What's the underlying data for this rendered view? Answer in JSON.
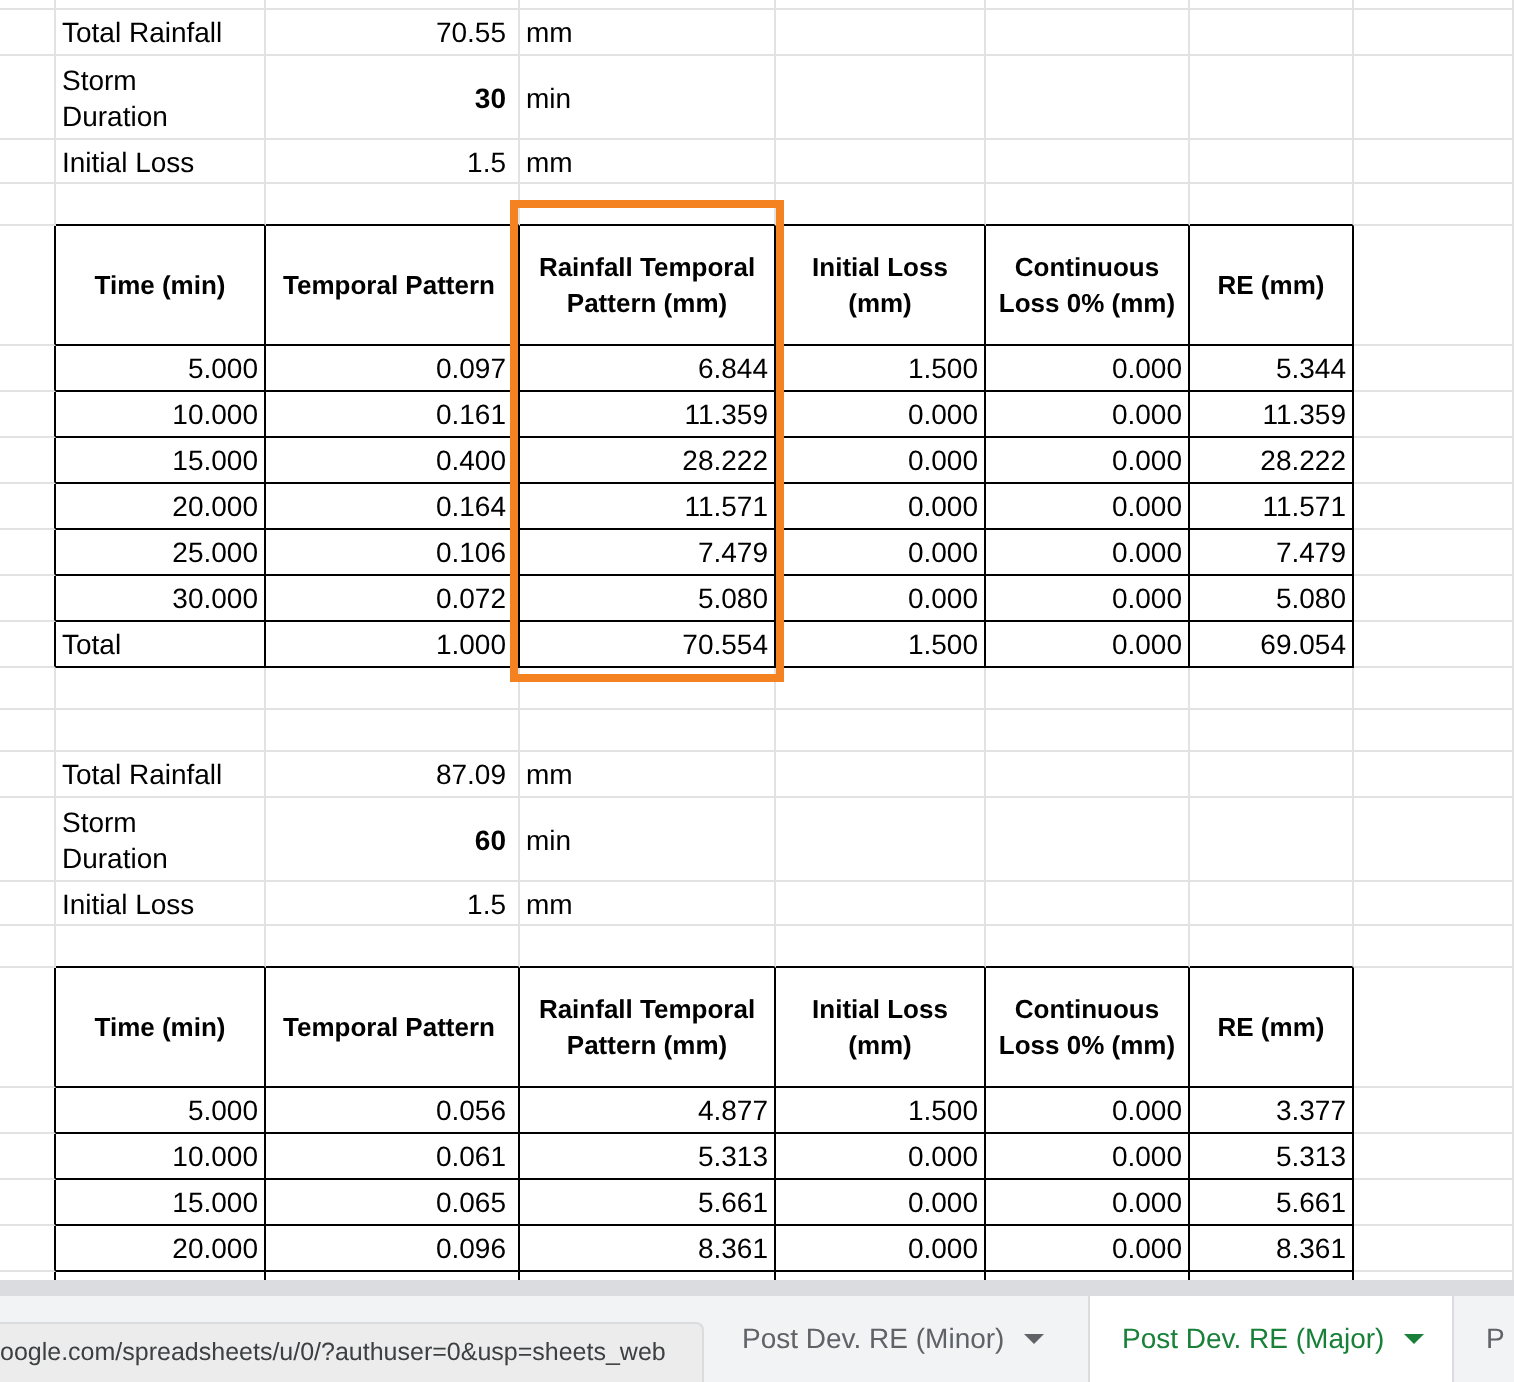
{
  "blocks": [
    {
      "parameters": [
        {
          "label": "Total Rainfall",
          "value": "70.55",
          "unit": "mm",
          "emphasis": false
        },
        {
          "label": "Storm Duration",
          "value": "30",
          "unit": "min",
          "emphasis": true
        },
        {
          "label": "Initial Loss",
          "value": "1.5",
          "unit": "mm",
          "emphasis": false
        }
      ],
      "table": {
        "columns": [
          {
            "label": "Time (min)",
            "highlighted": false
          },
          {
            "label": "Temporal Pattern",
            "highlighted": false
          },
          {
            "label": "Rainfall Temporal Pattern (mm)",
            "highlighted": true
          },
          {
            "label": "Initial Loss (mm)",
            "highlighted": false
          },
          {
            "label": "Continuous Loss 0% (mm)",
            "highlighted": false
          },
          {
            "label": "RE (mm)",
            "highlighted": false
          }
        ],
        "rows": [
          [
            "5.000",
            "0.097",
            "6.844",
            "1.500",
            "0.000",
            "5.344"
          ],
          [
            "10.000",
            "0.161",
            "11.359",
            "0.000",
            "0.000",
            "11.359"
          ],
          [
            "15.000",
            "0.400",
            "28.222",
            "0.000",
            "0.000",
            "28.222"
          ],
          [
            "20.000",
            "0.164",
            "11.571",
            "0.000",
            "0.000",
            "11.571"
          ],
          [
            "25.000",
            "0.106",
            "7.479",
            "0.000",
            "0.000",
            "7.479"
          ],
          [
            "30.000",
            "0.072",
            "5.080",
            "0.000",
            "0.000",
            "5.080"
          ]
        ],
        "total": [
          "Total",
          "1.000",
          "70.554",
          "1.500",
          "0.000",
          "69.054"
        ]
      }
    },
    {
      "parameters": [
        {
          "label": "Total Rainfall",
          "value": "87.09",
          "unit": "mm",
          "emphasis": false
        },
        {
          "label": "Storm Duration",
          "value": "60",
          "unit": "min",
          "emphasis": true
        },
        {
          "label": "Initial Loss",
          "value": "1.5",
          "unit": "mm",
          "emphasis": false
        }
      ],
      "table": {
        "columns": [
          {
            "label": "Time (min)",
            "highlighted": false
          },
          {
            "label": "Temporal Pattern",
            "highlighted": false
          },
          {
            "label": "Rainfall Temporal Pattern (mm)",
            "highlighted": false
          },
          {
            "label": "Initial Loss (mm)",
            "highlighted": false
          },
          {
            "label": "Continuous Loss 0% (mm)",
            "highlighted": false
          },
          {
            "label": "RE (mm)",
            "highlighted": false
          }
        ],
        "rows": [
          [
            "5.000",
            "0.056",
            "4.877",
            "1.500",
            "0.000",
            "3.377"
          ],
          [
            "10.000",
            "0.061",
            "5.313",
            "0.000",
            "0.000",
            "5.313"
          ],
          [
            "15.000",
            "0.065",
            "5.661",
            "0.000",
            "0.000",
            "5.661"
          ],
          [
            "20.000",
            "0.096",
            "8.361",
            "0.000",
            "0.000",
            "8.361"
          ]
        ]
      }
    }
  ],
  "sheet_tabs": [
    {
      "label": "Post Dev. RE (Minor)",
      "selected": false
    },
    {
      "label": "Post Dev. RE (Major)",
      "selected": true
    },
    {
      "label": "P",
      "selected": false
    }
  ],
  "status_url": "oogle.com/spreadsheets/u/0/?authuser=0&usp=sheets_web"
}
